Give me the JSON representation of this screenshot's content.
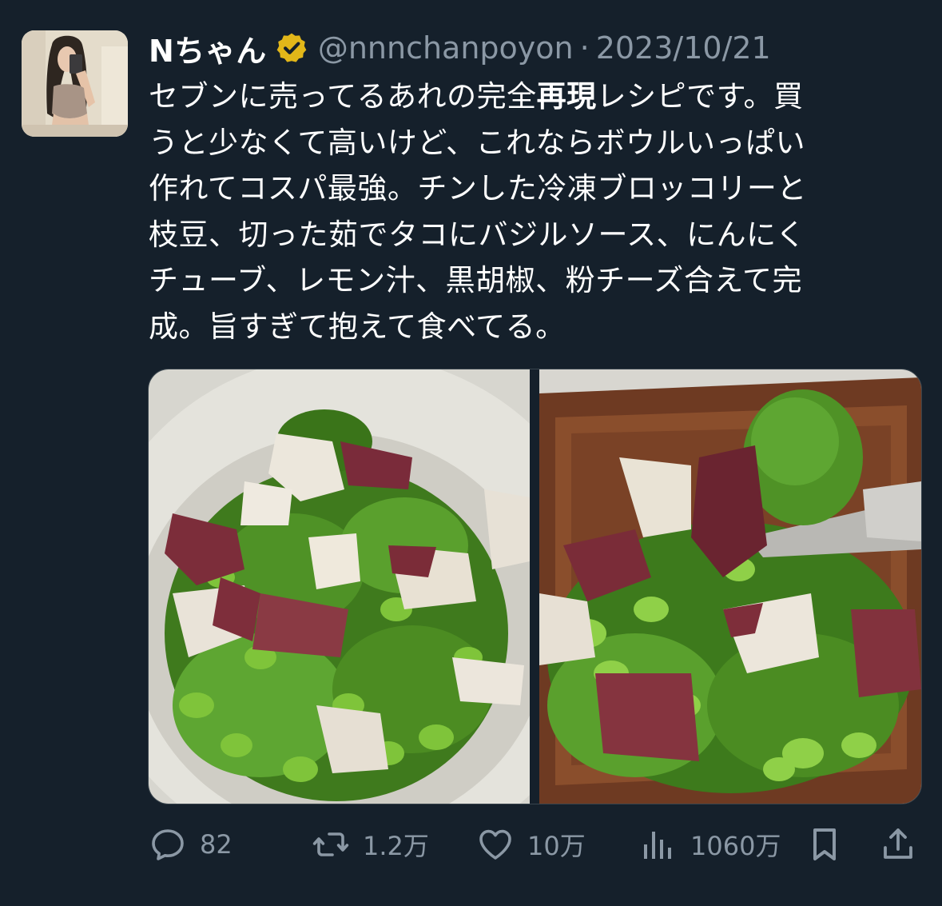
{
  "tweet": {
    "display_name": "Nちゃん",
    "handle": "@nnnchanpoyon",
    "separator": "·",
    "date": "2023/10/21",
    "text_lines": [
      {
        "before": "セブンに売ってるあれの完全",
        "bold": "再現",
        "after": "レシピです。買"
      },
      {
        "before": "うと少なくて高いけど、これならボウルいっぱい",
        "bold": "",
        "after": ""
      },
      {
        "before": "作れてコスパ最強。チンした冷凍ブロッコリーと",
        "bold": "",
        "after": ""
      },
      {
        "before": "枝豆、切った茹でタコにバジルソース、にんにく",
        "bold": "",
        "after": ""
      },
      {
        "before": "チューブ、レモン汁、黒胡椒、粉チーズ合えて完",
        "bold": "",
        "after": ""
      },
      {
        "before": "成。旨すぎて抱えて食べてる。",
        "bold": "",
        "after": ""
      }
    ]
  },
  "actions": {
    "reply_count": "82",
    "retweet_count": "1.2万",
    "like_count": "10万",
    "views_count": "1060万"
  },
  "icons": {
    "verified": "verified-badge-icon",
    "reply": "reply-icon",
    "retweet": "retweet-icon",
    "like": "heart-icon",
    "views": "views-chart-icon",
    "bookmark": "bookmark-icon",
    "share": "share-icon"
  },
  "colors": {
    "background": "#15202b",
    "text_primary": "#ffffff",
    "text_secondary": "#8b98a5",
    "verified_gold": "#e2b719"
  }
}
